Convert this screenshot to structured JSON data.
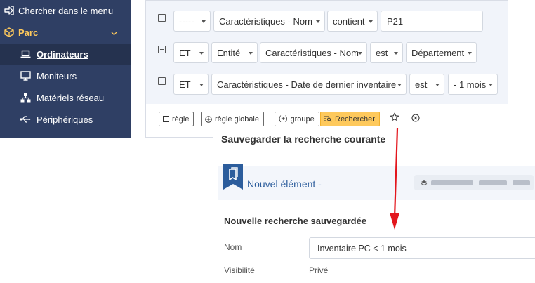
{
  "sidebar": {
    "search_menu": "Chercher dans le menu",
    "parc": "Parc",
    "items": [
      {
        "label": "Ordinateurs"
      },
      {
        "label": "Moniteurs"
      },
      {
        "label": "Matériels réseau"
      },
      {
        "label": "Périphériques"
      }
    ]
  },
  "criteria": [
    {
      "link": "-----",
      "field": "Caractéristiques - Nom",
      "operator": "contient",
      "value": "P21"
    },
    {
      "link": "ET",
      "itemtype": "Entité",
      "field": "Caractéristiques - Nom",
      "operator": "est",
      "value": "Département"
    },
    {
      "link": "ET",
      "field": "Caractéristiques - Date de dernier inventaire",
      "operator": "est",
      "value": "- 1 mois"
    }
  ],
  "actions": {
    "rule": "règle",
    "global_rule": "règle globale",
    "group": "groupe",
    "search": "Rechercher"
  },
  "modal": {
    "title": "Sauvegarder la recherche courante",
    "new_item": "Nouvel élément -",
    "section": "Nouvelle recherche sauvegardée",
    "name_label": "Nom",
    "name_value": "Inventaire PC < 1 mois",
    "visibility_label": "Visibilité",
    "visibility_value": "Privé"
  },
  "colors": {
    "sidebar_bg": "#2f3f64",
    "accent": "#fec95c",
    "link": "#2c5d9c",
    "arrow": "#e3161d"
  }
}
